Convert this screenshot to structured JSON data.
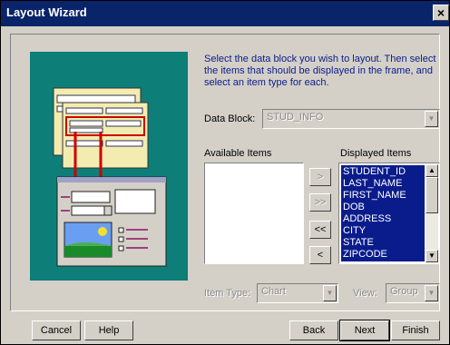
{
  "window": {
    "title": "Layout Wizard",
    "close_glyph": "×"
  },
  "instructions": "Select the data block you wish to layout. Then select the items that should be displayed in the frame, and select an item type for each.",
  "data_block": {
    "label": "Data Block:",
    "value": "STUD_INFO"
  },
  "available": {
    "label": "Available Items",
    "items": []
  },
  "displayed": {
    "label": "Displayed Items",
    "items": [
      "STUDENT_ID",
      "LAST_NAME",
      "FIRST_NAME",
      "DOB",
      "ADDRESS",
      "CITY",
      "STATE",
      "ZIPCODE"
    ]
  },
  "transfer": {
    "add": ">",
    "add_all": ">>",
    "remove_all": "<<",
    "remove": "<"
  },
  "item_type": {
    "label": "Item Type:",
    "value": "Chart"
  },
  "view": {
    "label": "View:",
    "value": "Group"
  },
  "buttons": {
    "cancel": "Cancel",
    "help": "Help",
    "back": "Back",
    "next": "Next",
    "finish": "Finish"
  },
  "colors": {
    "title_bar": "#0a246a",
    "illustration_bg": "#0e7e78",
    "selection": "#0a1c8c"
  }
}
